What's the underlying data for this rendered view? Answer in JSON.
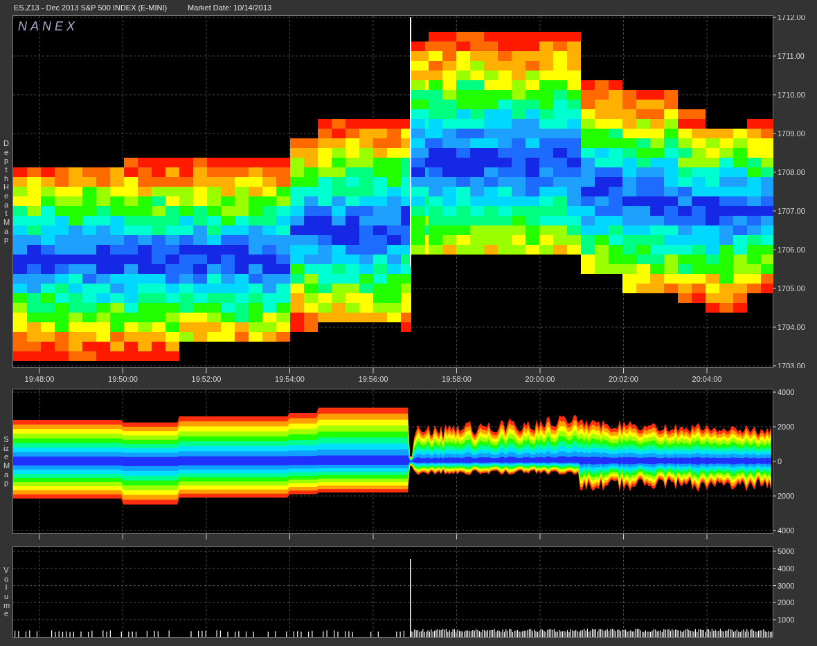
{
  "title": "ES.Z13 - Dec 2013 S&P 500 INDEX (E-MINI)",
  "market_date": "Market Date: 10/14/2013",
  "logo": "NANEX",
  "panels": [
    {
      "kind": "heat",
      "label": "Depth Heat Map",
      "y_labels": [
        "1712.00",
        "1711.00",
        "1710.00",
        "1709.00",
        "1708.00",
        "1707.00",
        "1706.00",
        "1705.00",
        "1704.00",
        "1703.00"
      ]
    },
    {
      "kind": "size",
      "label": "Size Map",
      "y_labels": [
        "4000",
        "2000",
        "0",
        "2000",
        "4000"
      ]
    },
    {
      "kind": "volume",
      "label": "Volume",
      "y_labels": [
        "5000",
        "4000",
        "3000",
        "2000",
        "1000"
      ]
    }
  ],
  "time_labels": [
    "19:48:00",
    "19:50:00",
    "19:52:00",
    "19:54:00",
    "19:56:00",
    "19:58:00",
    "20:00:00",
    "20:02:00",
    "20:04:00"
  ]
}
